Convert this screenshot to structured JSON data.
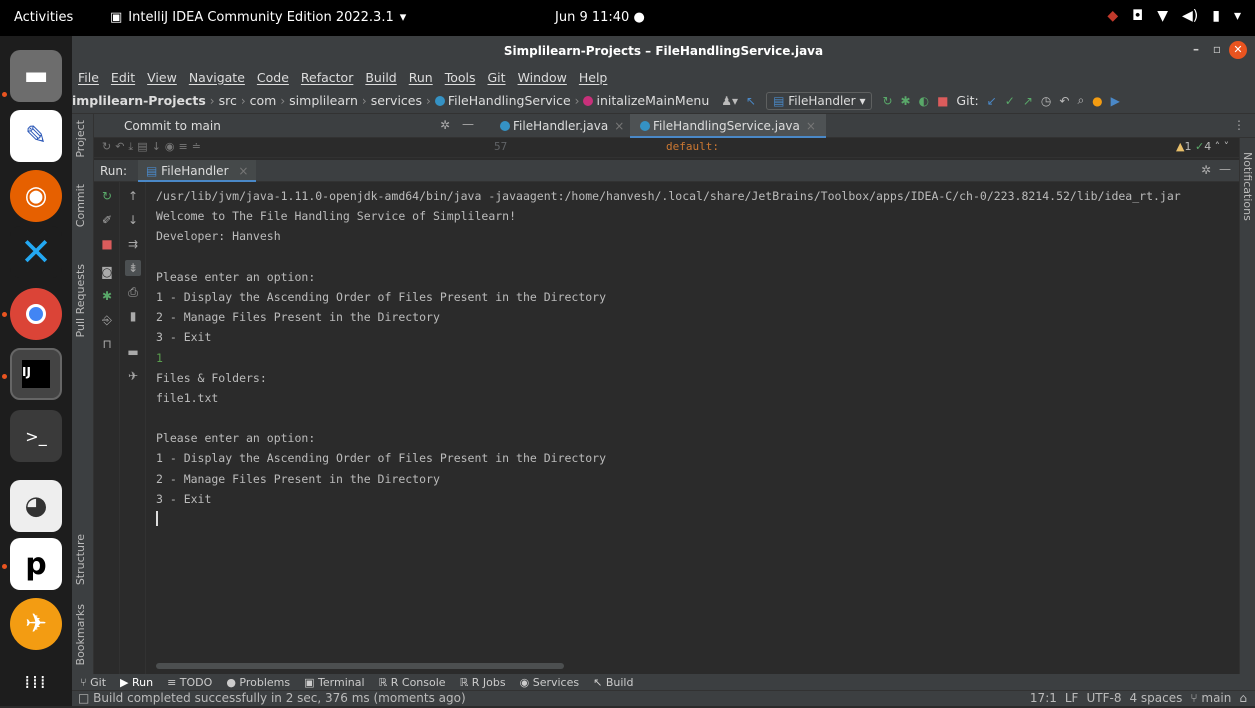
{
  "topbar": {
    "activities": "Activities",
    "app_name": "IntelliJ IDEA Community Edition 2022.3.1",
    "clock": "Jun 9  11:40"
  },
  "window": {
    "title": "Simplilearn-Projects – FileHandlingService.java"
  },
  "menu": [
    "File",
    "Edit",
    "View",
    "Navigate",
    "Code",
    "Refactor",
    "Build",
    "Run",
    "Tools",
    "Git",
    "Window",
    "Help"
  ],
  "breadcrumb": {
    "project": "implilearn-Projects",
    "items": [
      "src",
      "com",
      "simplilearn",
      "services"
    ],
    "class_name": "FileHandlingService",
    "method_name": "initalizeMainMenu"
  },
  "toolbar": {
    "run_config": "FileHandler",
    "git_label": "Git:"
  },
  "left_tabs": {
    "project": "Project",
    "commit": "Commit",
    "pull_requests": "Pull Requests",
    "structure": "Structure",
    "bookmarks": "Bookmarks"
  },
  "commit_panel": {
    "label": "Commit to main"
  },
  "editor": {
    "tabs": [
      {
        "label": "FileHandler.java"
      },
      {
        "label": "FileHandlingService.java"
      }
    ],
    "line_number": "57",
    "code_line": "default:",
    "inspection_warnings": "1",
    "inspection_ok": "4"
  },
  "right_tabs": {
    "notifications": "Notifications"
  },
  "run_panel": {
    "label": "Run:",
    "tab": "FileHandler"
  },
  "console": {
    "lines": [
      "/usr/lib/jvm/java-1.11.0-openjdk-amd64/bin/java -javaagent:/home/hanvesh/.local/share/JetBrains/Toolbox/apps/IDEA-C/ch-0/223.8214.52/lib/idea_rt.jar",
      "Welcome to The File Handling Service of Simplilearn!",
      "Developer: Hanvesh",
      "",
      "Please enter an option:",
      "1 - Display the Ascending Order of Files Present in the Directory",
      "2 - Manage Files Present in the Directory",
      "3 - Exit",
      "1",
      "Files & Folders:",
      "file1.txt",
      "",
      "Please enter an option:",
      "1 - Display the Ascending Order of Files Present in the Directory",
      "2 - Manage Files Present in the Directory",
      "3 - Exit"
    ]
  },
  "bottom_tabs": [
    "Git",
    "Run",
    "TODO",
    "Problems",
    "Terminal",
    "R Console",
    "R Jobs",
    "Services",
    "Build"
  ],
  "status": {
    "message": "Build completed successfully in 2 sec, 376 ms (moments ago)",
    "position": "17:1",
    "line_sep": "LF",
    "encoding": "UTF-8",
    "indent": "4 spaces",
    "branch": "main"
  }
}
